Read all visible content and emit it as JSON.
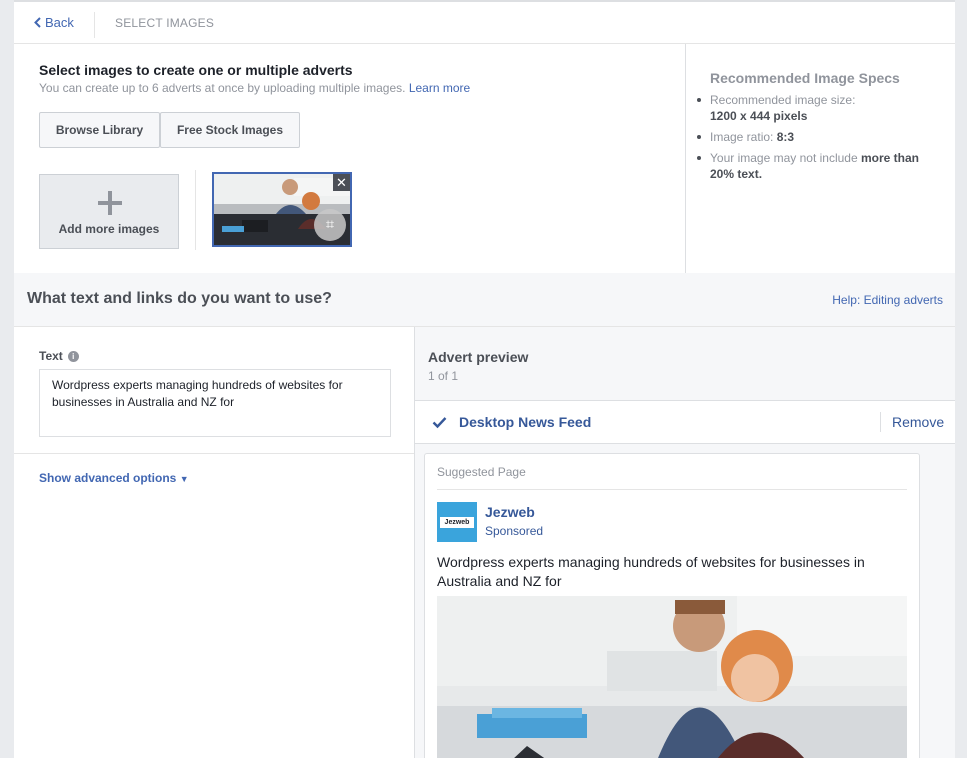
{
  "topbar": {
    "back_label": "Back",
    "breadcrumb": "SELECT IMAGES"
  },
  "images": {
    "heading": "Select images to create one or multiple adverts",
    "subtext": "You can create up to 6 adverts at once by uploading multiple images.",
    "learn_more": "Learn more",
    "browse_library": "Browse Library",
    "free_stock": "Free Stock Images",
    "add_more": "Add more images",
    "remove_glyph": "✕",
    "crop_glyph": "⌗"
  },
  "specs": {
    "title": "Recommended Image Specs",
    "size_label": "Recommended image size:",
    "size_value": "1200 x 444 pixels",
    "ratio_label": "Image ratio:",
    "ratio_value": "8:3",
    "text_label": "Your image may not include",
    "text_value": "more than 20% text."
  },
  "section": {
    "title": "What text and links do you want to use?",
    "help": "Help: Editing adverts"
  },
  "form": {
    "text_label": "Text",
    "info_glyph": "i",
    "text_value": "Wordpress experts managing hundreds of websites for businesses in Australia and NZ for",
    "advanced": "Show advanced options",
    "advanced_caret": "▼"
  },
  "preview": {
    "title": "Advert preview",
    "count": "1 of 1",
    "placement": "Desktop News Feed",
    "remove": "Remove",
    "suggested": "Suggested Page",
    "page_name": "Jezweb",
    "logo_text": "Jezweb",
    "sponsored": "Sponsored",
    "post_text": "Wordpress experts managing hundreds of websites for businesses in Australia and NZ for"
  },
  "colors": {
    "accent": "#4267b2",
    "link": "#365899",
    "background": "#e9ebee"
  }
}
